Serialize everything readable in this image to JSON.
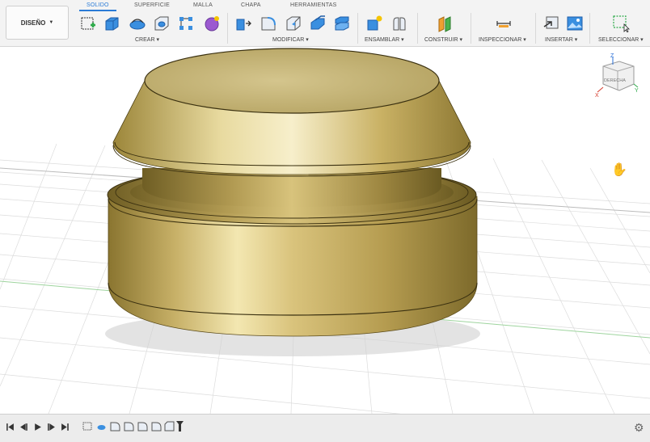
{
  "workspace": {
    "label": "DISEÑO"
  },
  "tabs": [
    {
      "label": "SOLIDO",
      "active": true
    },
    {
      "label": "SUPERFICIE"
    },
    {
      "label": "MALLA"
    },
    {
      "label": "CHAPA"
    },
    {
      "label": "HERRAMIENTAS"
    }
  ],
  "groups": [
    {
      "label": "CREAR ▾"
    },
    {
      "label": "MODIFICAR ▾"
    },
    {
      "label": "ENSAMBLAR ▾"
    },
    {
      "label": "CONSTRUIR ▾"
    },
    {
      "label": "INSPECCIONAR ▾"
    },
    {
      "label": "INSERTAR ▾"
    },
    {
      "label": "SELECCIONAR ▾"
    }
  ],
  "viewcube": {
    "face": "DERECHA",
    "axis_z": "Z",
    "axis_x": "X",
    "axis_y": "Y"
  },
  "colors": {
    "accent": "#2a7bd6",
    "gold": "#c9b36a"
  }
}
